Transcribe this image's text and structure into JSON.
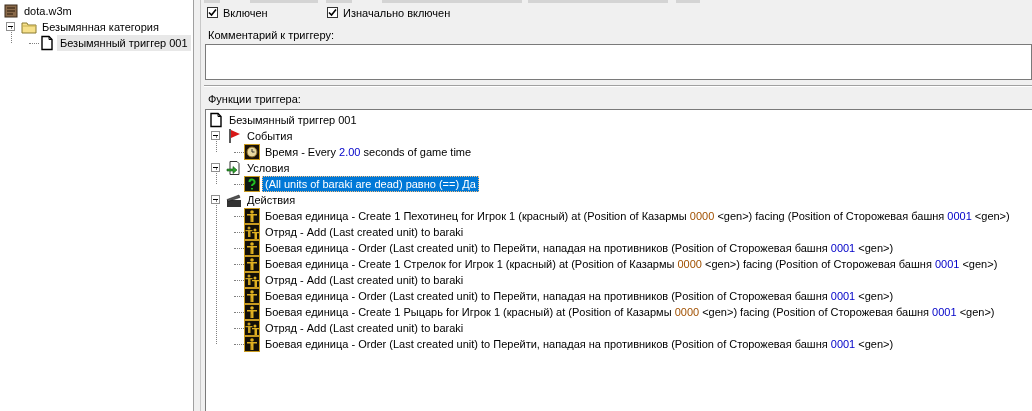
{
  "file_tree": {
    "label": "dota.w3m",
    "kind": "map",
    "children": [
      {
        "label": "Безымянная категория",
        "kind": "folder",
        "expanded": true,
        "children": [
          {
            "label": "Безымянный триггер 001",
            "kind": "trigger",
            "selected": true
          }
        ]
      }
    ]
  },
  "checkboxes": [
    {
      "label": "Включен",
      "checked": true
    },
    {
      "label": "Изначально включен",
      "checked": true
    }
  ],
  "comment_label": "Комментарий к триггеру:",
  "functions": {
    "label": "Функции триггера:",
    "tree": {
      "kind": "trigger",
      "label": "Безымянный триггер 001",
      "children": [
        {
          "kind": "events",
          "expanded": true,
          "label": "События",
          "children": [
            {
              "kind": "clock",
              "selected": false,
              "parts": [
                {
                  "text": "Время - Every ",
                  "kind": "text"
                },
                {
                  "text": "2.00",
                  "kind": "value"
                },
                {
                  "text": " seconds of game time",
                  "kind": "text"
                }
              ]
            }
          ]
        },
        {
          "kind": "conditions",
          "expanded": true,
          "label": "Условия",
          "children": [
            {
              "kind": "question",
              "selected": true,
              "parts": [
                {
                  "text": "(All units of baraki are dead) равно (==) Да",
                  "kind": "text"
                }
              ]
            }
          ]
        },
        {
          "kind": "actions",
          "expanded": true,
          "label": "Действия",
          "children": [
            {
              "kind": "unit",
              "selected": false,
              "parts": [
                {
                  "text": "Боевая единица - Create 1 Пехотинец for Игрок 1 (красный) at (Position of Казармы ",
                  "kind": "text"
                },
                {
                  "text": "0000",
                  "kind": "preset"
                },
                {
                  "text": " <gen>) facing (Position of Сторожевая башня ",
                  "kind": "text"
                },
                {
                  "text": "0001",
                  "kind": "value"
                },
                {
                  "text": " <gen>)",
                  "kind": "text"
                }
              ]
            },
            {
              "kind": "group",
              "selected": false,
              "parts": [
                {
                  "text": "Отряд - Add (Last created unit) to baraki",
                  "kind": "text"
                }
              ]
            },
            {
              "kind": "unit",
              "selected": false,
              "parts": [
                {
                  "text": "Боевая единица - Order (Last created unit) to Перейти, нападая на противников (Position of Сторожевая башня ",
                  "kind": "text"
                },
                {
                  "text": "0001",
                  "kind": "value"
                },
                {
                  "text": " <gen>)",
                  "kind": "text"
                }
              ]
            },
            {
              "kind": "unit",
              "selected": false,
              "parts": [
                {
                  "text": "Боевая единица - Create 1 Стрелок for Игрок 1 (красный) at (Position of Казармы ",
                  "kind": "text"
                },
                {
                  "text": "0000",
                  "kind": "preset"
                },
                {
                  "text": " <gen>) facing (Position of Сторожевая башня ",
                  "kind": "text"
                },
                {
                  "text": "0001",
                  "kind": "value"
                },
                {
                  "text": " <gen>)",
                  "kind": "text"
                }
              ]
            },
            {
              "kind": "group",
              "selected": false,
              "parts": [
                {
                  "text": "Отряд - Add (Last created unit) to baraki",
                  "kind": "text"
                }
              ]
            },
            {
              "kind": "unit",
              "selected": false,
              "parts": [
                {
                  "text": "Боевая единица - Order (Last created unit) to Перейти, нападая на противников (Position of Сторожевая башня ",
                  "kind": "text"
                },
                {
                  "text": "0001",
                  "kind": "value"
                },
                {
                  "text": " <gen>)",
                  "kind": "text"
                }
              ]
            },
            {
              "kind": "unit",
              "selected": false,
              "parts": [
                {
                  "text": "Боевая единица - Create 1 Рыцарь for Игрок 1 (красный) at (Position of Казармы ",
                  "kind": "text"
                },
                {
                  "text": "0000",
                  "kind": "preset"
                },
                {
                  "text": " <gen>) facing (Position of Сторожевая башня ",
                  "kind": "text"
                },
                {
                  "text": "0001",
                  "kind": "value"
                },
                {
                  "text": " <gen>)",
                  "kind": "text"
                }
              ]
            },
            {
              "kind": "group",
              "selected": false,
              "parts": [
                {
                  "text": "Отряд - Add (Last created unit) to baraki",
                  "kind": "text"
                }
              ]
            },
            {
              "kind": "unit",
              "selected": false,
              "parts": [
                {
                  "text": "Боевая единица - Order (Last created unit) to Перейти, нападая на противников (Position of Сторожевая башня ",
                  "kind": "text"
                },
                {
                  "text": "0001",
                  "kind": "value"
                },
                {
                  "text": " <gen>)",
                  "kind": "text"
                }
              ]
            }
          ]
        }
      ]
    }
  }
}
